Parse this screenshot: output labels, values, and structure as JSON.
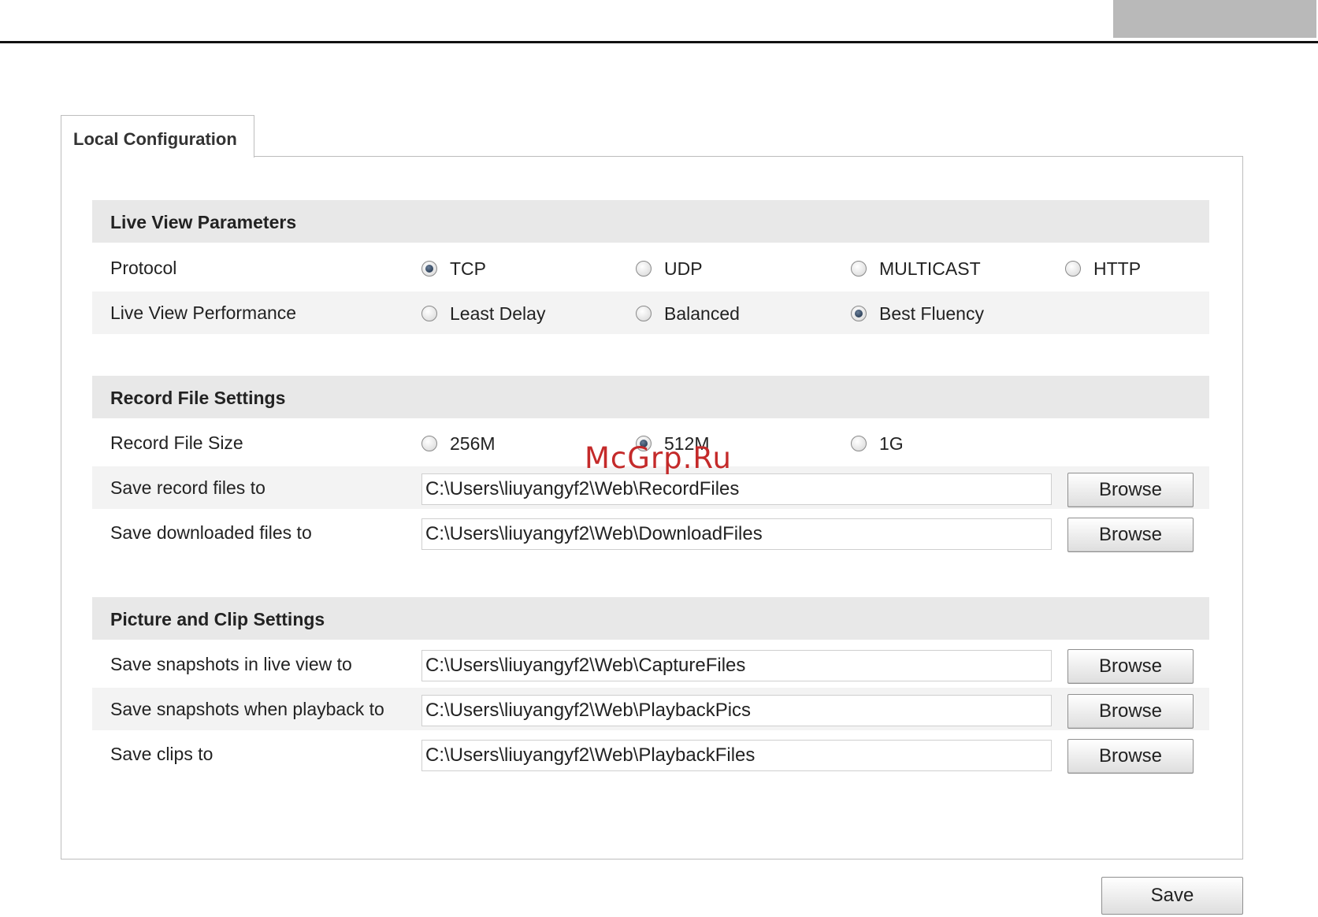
{
  "tab": {
    "label": "Local Configuration"
  },
  "sections": {
    "live_view": {
      "title": "Live View Parameters",
      "protocol": {
        "label": "Protocol",
        "options": [
          "TCP",
          "UDP",
          "MULTICAST",
          "HTTP"
        ],
        "selected": "TCP"
      },
      "performance": {
        "label": "Live View Performance",
        "options": [
          "Least Delay",
          "Balanced",
          "Best Fluency"
        ],
        "selected": "Best Fluency"
      }
    },
    "record": {
      "title": "Record File Settings",
      "file_size": {
        "label": "Record File Size",
        "options": [
          "256M",
          "512M",
          "1G"
        ],
        "selected": "512M"
      },
      "record_path": {
        "label": "Save record files to",
        "value": "C:\\Users\\liuyangyf2\\Web\\RecordFiles"
      },
      "download_path": {
        "label": "Save downloaded files to",
        "value": "C:\\Users\\liuyangyf2\\Web\\DownloadFiles"
      }
    },
    "picture": {
      "title": "Picture and Clip Settings",
      "snapshot_live_path": {
        "label": "Save snapshots in live view to",
        "value": "C:\\Users\\liuyangyf2\\Web\\CaptureFiles"
      },
      "snapshot_playback_path": {
        "label": "Save snapshots when playback to",
        "value": "C:\\Users\\liuyangyf2\\Web\\PlaybackPics"
      },
      "clips_path": {
        "label": "Save clips to",
        "value": "C:\\Users\\liuyangyf2\\Web\\PlaybackFiles"
      }
    }
  },
  "buttons": {
    "browse": "Browse",
    "save": "Save"
  },
  "watermark": "McGrp.Ru",
  "colors": {
    "section_header_bg": "#e8e8e8",
    "alt_row_bg": "#f3f3f3",
    "border": "#bdbdbd",
    "watermark": "#c42a2a"
  }
}
